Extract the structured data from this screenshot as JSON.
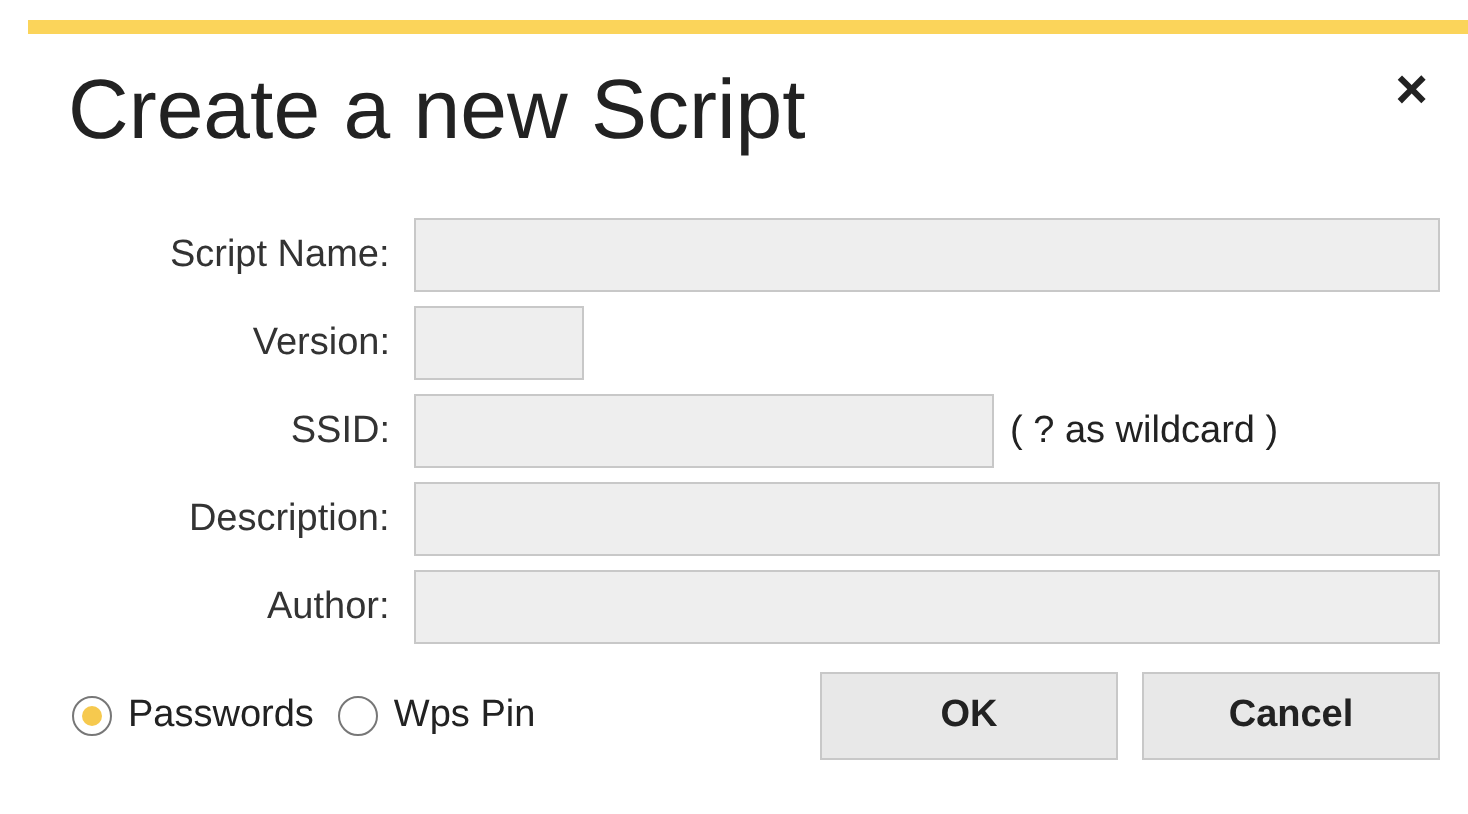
{
  "dialog": {
    "title": "Create a new Script",
    "close": "×"
  },
  "fields": [
    {
      "label": "Script Name:",
      "kind": "wide"
    },
    {
      "label": "Version:",
      "kind": "short"
    },
    {
      "label": "SSID:",
      "kind": "medium",
      "hint": "( ? as wildcard )"
    },
    {
      "label": "Description:",
      "kind": "wide"
    },
    {
      "label": "Author:",
      "kind": "wide"
    }
  ],
  "options": [
    {
      "label": "Passwords",
      "selected": true
    },
    {
      "label": "Wps Pin",
      "selected": false
    }
  ],
  "buttons": [
    "OK",
    "Cancel"
  ]
}
